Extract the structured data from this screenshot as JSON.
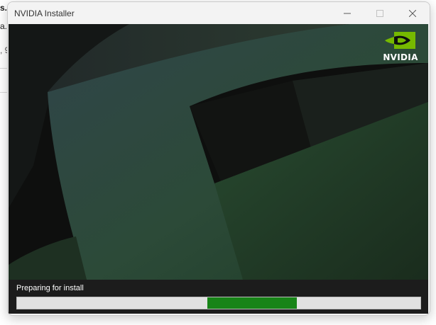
{
  "background_window": {
    "fragments": [
      "s.e",
      "a.e",
      ", 9"
    ]
  },
  "window": {
    "title": "NVIDIA Installer",
    "controls": {
      "minimize_icon": "minimize-icon",
      "maximize_icon": "maximize-icon",
      "close_icon": "close-icon"
    }
  },
  "logo": {
    "text": "NVIDIA",
    "accent": "#76b900"
  },
  "status": {
    "text": "Preparing for install"
  },
  "progress": {
    "type": "marquee",
    "segment_start": 0.472,
    "segment_end": 0.694,
    "fill_color": "#178417",
    "track_color": "#e1e1e1"
  }
}
